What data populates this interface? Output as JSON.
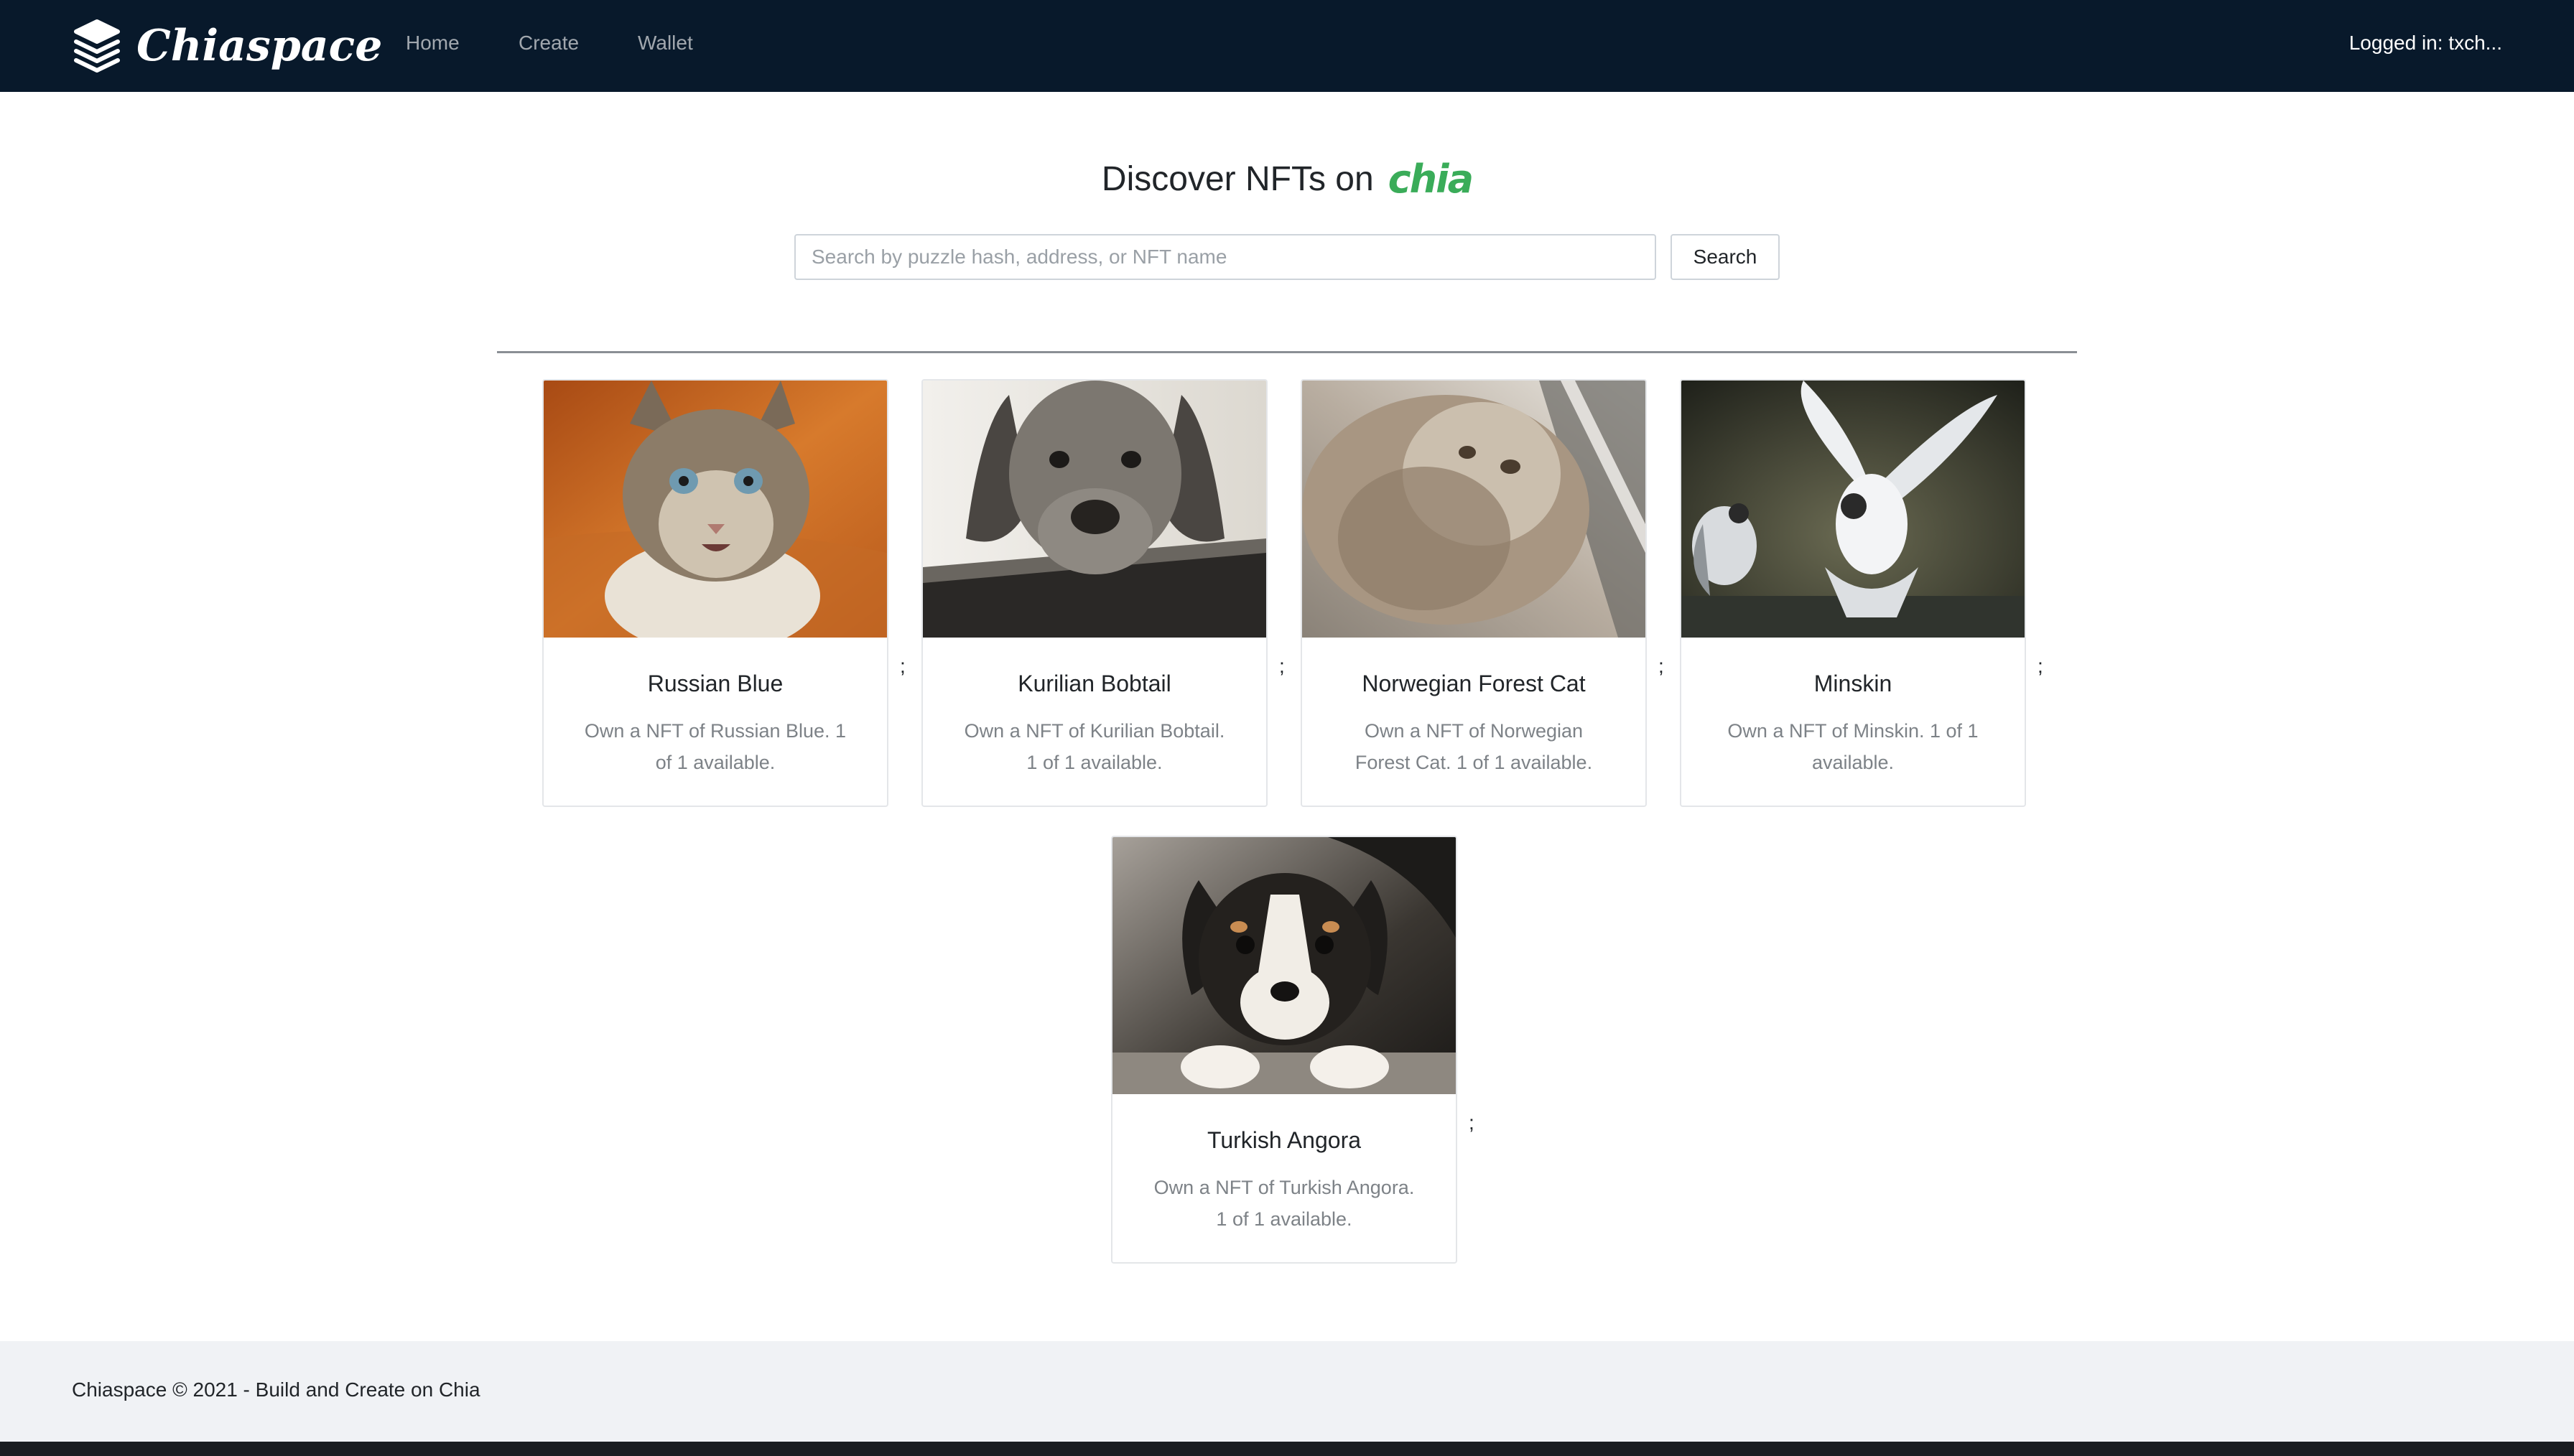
{
  "navbar": {
    "brand": "Chiaspace",
    "links": [
      "Home",
      "Create",
      "Wallet"
    ],
    "status": "Logged in: txch..."
  },
  "hero": {
    "title": "Discover NFTs on",
    "logo_text": "chia",
    "logo_color": "#3aac59"
  },
  "search": {
    "placeholder": "Search by puzzle hash, address, or NFT name",
    "value": "",
    "button": "Search"
  },
  "nfts": [
    {
      "name": "Russian Blue",
      "description": "Own a NFT of Russian Blue. 1 of 1 available.",
      "separator": ";"
    },
    {
      "name": "Kurilian Bobtail",
      "description": "Own a NFT of Kurilian Bobtail. 1 of 1 available.",
      "separator": ";"
    },
    {
      "name": "Norwegian Forest Cat",
      "description": "Own a NFT of Norwegian Forest Cat. 1 of 1 available.",
      "separator": ";"
    },
    {
      "name": "Minskin",
      "description": "Own a NFT of Minskin. 1 of 1 available.",
      "separator": ";"
    },
    {
      "name": "Turkish Angora",
      "description": "Own a NFT of Turkish Angora. 1 of 1 available.",
      "separator": ";"
    }
  ],
  "footer": {
    "text": "Chiaspace © 2021 - Build and Create on Chia"
  },
  "colors": {
    "navbar_bg": "#08192b",
    "footer_bg": "#f0f2f5",
    "accent": "#3aac59"
  }
}
